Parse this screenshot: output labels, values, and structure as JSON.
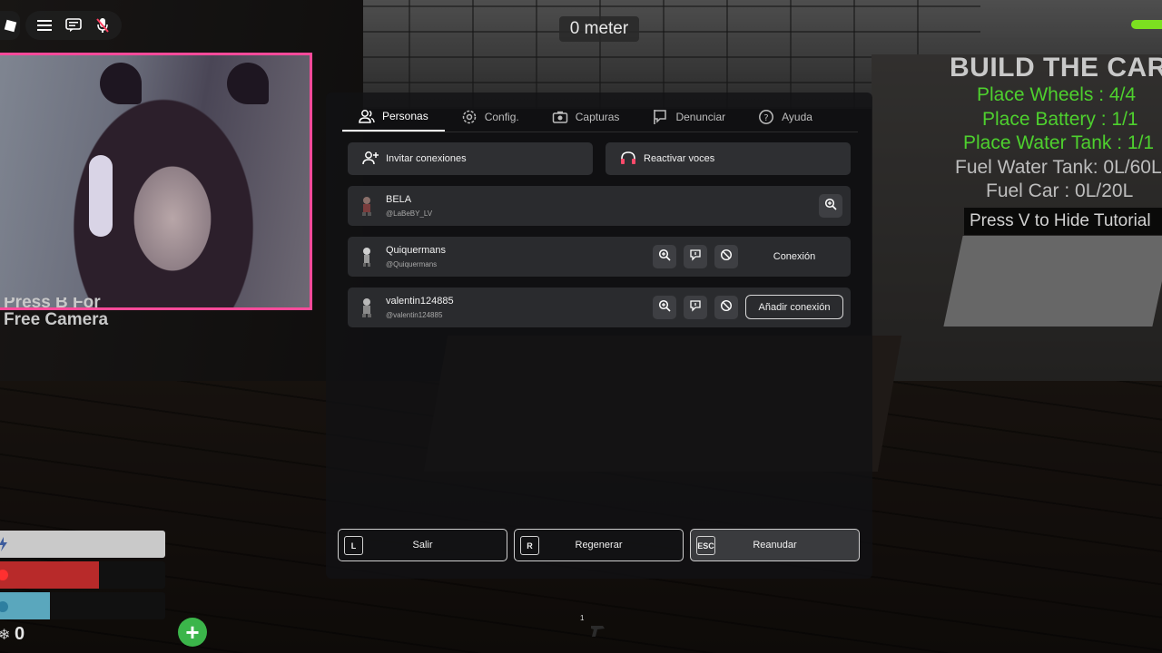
{
  "hud": {
    "distance": "0 meter",
    "free_camera_hint_line1": "Press B For",
    "free_camera_hint_line2": "Free Camera",
    "coins": "0"
  },
  "tutorial": {
    "title": "BUILD THE CAR",
    "steps": [
      {
        "text": "Place Wheels : 4/4",
        "done": true
      },
      {
        "text": "Place Battery : 1/1",
        "done": true
      },
      {
        "text": "Place Water Tank : 1/1",
        "done": true
      },
      {
        "text": "Fuel Water Tank: 0L/60L",
        "done": false
      },
      {
        "text": "Fuel Car : 0L/20L",
        "done": false
      }
    ],
    "hide_hint": "Press V to Hide Tutorial"
  },
  "menu": {
    "tabs": [
      {
        "label": "Personas",
        "icon": "people-icon",
        "active": true
      },
      {
        "label": "Config.",
        "icon": "gear-icon",
        "active": false
      },
      {
        "label": "Capturas",
        "icon": "camera-icon",
        "active": false
      },
      {
        "label": "Denunciar",
        "icon": "flag-icon",
        "active": false
      },
      {
        "label": "Ayuda",
        "icon": "help-icon",
        "active": false
      }
    ],
    "invite_label": "Invitar conexiones",
    "voices_label": "Reactivar voces",
    "players": [
      {
        "name": "BELA",
        "username": "@LaBeBY_LV"
      },
      {
        "name": "Quiquermans",
        "username": "@Quiquermans",
        "action": "Conexión"
      },
      {
        "name": "valentin124885",
        "username": "@valentin124885",
        "action": "Añadir conexión"
      }
    ],
    "bottom_buttons": [
      {
        "key": "L",
        "label": "Salir"
      },
      {
        "key": "R",
        "label": "Regenerar"
      },
      {
        "key": "ESC",
        "label": "Reanudar"
      }
    ]
  },
  "stats": {
    "stamina_fraction": 1.0,
    "health_fraction": 0.6,
    "water_fraction": 0.3
  },
  "hotbar": {
    "slot_number": "1"
  },
  "colors": {
    "tutorial_done": "#4ed02e",
    "webcam_border": "#ff4a9a",
    "health": "#b82a2a",
    "water": "#5aa7bd",
    "stamina": "#c9c9c9",
    "plus_button": "#3bb54a"
  }
}
